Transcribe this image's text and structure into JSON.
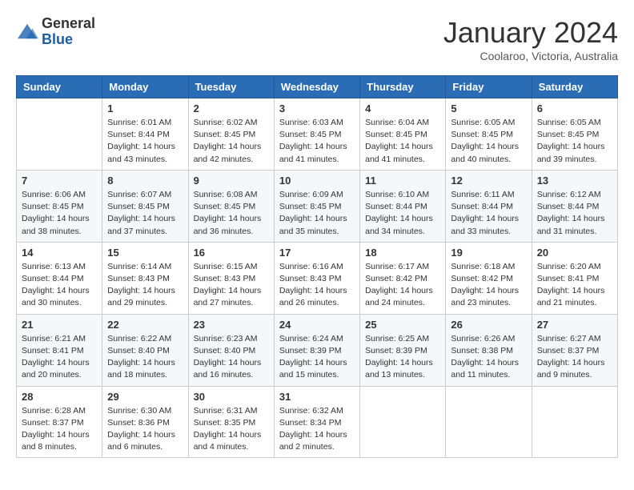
{
  "logo": {
    "line1": "General",
    "line2": "Blue"
  },
  "title": "January 2024",
  "location": "Coolaroo, Victoria, Australia",
  "days_header": [
    "Sunday",
    "Monday",
    "Tuesday",
    "Wednesday",
    "Thursday",
    "Friday",
    "Saturday"
  ],
  "weeks": [
    [
      {
        "day": "",
        "sunrise": "",
        "sunset": "",
        "daylight": ""
      },
      {
        "day": "1",
        "sunrise": "Sunrise: 6:01 AM",
        "sunset": "Sunset: 8:44 PM",
        "daylight": "Daylight: 14 hours and 43 minutes."
      },
      {
        "day": "2",
        "sunrise": "Sunrise: 6:02 AM",
        "sunset": "Sunset: 8:45 PM",
        "daylight": "Daylight: 14 hours and 42 minutes."
      },
      {
        "day": "3",
        "sunrise": "Sunrise: 6:03 AM",
        "sunset": "Sunset: 8:45 PM",
        "daylight": "Daylight: 14 hours and 41 minutes."
      },
      {
        "day": "4",
        "sunrise": "Sunrise: 6:04 AM",
        "sunset": "Sunset: 8:45 PM",
        "daylight": "Daylight: 14 hours and 41 minutes."
      },
      {
        "day": "5",
        "sunrise": "Sunrise: 6:05 AM",
        "sunset": "Sunset: 8:45 PM",
        "daylight": "Daylight: 14 hours and 40 minutes."
      },
      {
        "day": "6",
        "sunrise": "Sunrise: 6:05 AM",
        "sunset": "Sunset: 8:45 PM",
        "daylight": "Daylight: 14 hours and 39 minutes."
      }
    ],
    [
      {
        "day": "7",
        "sunrise": "Sunrise: 6:06 AM",
        "sunset": "Sunset: 8:45 PM",
        "daylight": "Daylight: 14 hours and 38 minutes."
      },
      {
        "day": "8",
        "sunrise": "Sunrise: 6:07 AM",
        "sunset": "Sunset: 8:45 PM",
        "daylight": "Daylight: 14 hours and 37 minutes."
      },
      {
        "day": "9",
        "sunrise": "Sunrise: 6:08 AM",
        "sunset": "Sunset: 8:45 PM",
        "daylight": "Daylight: 14 hours and 36 minutes."
      },
      {
        "day": "10",
        "sunrise": "Sunrise: 6:09 AM",
        "sunset": "Sunset: 8:45 PM",
        "daylight": "Daylight: 14 hours and 35 minutes."
      },
      {
        "day": "11",
        "sunrise": "Sunrise: 6:10 AM",
        "sunset": "Sunset: 8:44 PM",
        "daylight": "Daylight: 14 hours and 34 minutes."
      },
      {
        "day": "12",
        "sunrise": "Sunrise: 6:11 AM",
        "sunset": "Sunset: 8:44 PM",
        "daylight": "Daylight: 14 hours and 33 minutes."
      },
      {
        "day": "13",
        "sunrise": "Sunrise: 6:12 AM",
        "sunset": "Sunset: 8:44 PM",
        "daylight": "Daylight: 14 hours and 31 minutes."
      }
    ],
    [
      {
        "day": "14",
        "sunrise": "Sunrise: 6:13 AM",
        "sunset": "Sunset: 8:44 PM",
        "daylight": "Daylight: 14 hours and 30 minutes."
      },
      {
        "day": "15",
        "sunrise": "Sunrise: 6:14 AM",
        "sunset": "Sunset: 8:43 PM",
        "daylight": "Daylight: 14 hours and 29 minutes."
      },
      {
        "day": "16",
        "sunrise": "Sunrise: 6:15 AM",
        "sunset": "Sunset: 8:43 PM",
        "daylight": "Daylight: 14 hours and 27 minutes."
      },
      {
        "day": "17",
        "sunrise": "Sunrise: 6:16 AM",
        "sunset": "Sunset: 8:43 PM",
        "daylight": "Daylight: 14 hours and 26 minutes."
      },
      {
        "day": "18",
        "sunrise": "Sunrise: 6:17 AM",
        "sunset": "Sunset: 8:42 PM",
        "daylight": "Daylight: 14 hours and 24 minutes."
      },
      {
        "day": "19",
        "sunrise": "Sunrise: 6:18 AM",
        "sunset": "Sunset: 8:42 PM",
        "daylight": "Daylight: 14 hours and 23 minutes."
      },
      {
        "day": "20",
        "sunrise": "Sunrise: 6:20 AM",
        "sunset": "Sunset: 8:41 PM",
        "daylight": "Daylight: 14 hours and 21 minutes."
      }
    ],
    [
      {
        "day": "21",
        "sunrise": "Sunrise: 6:21 AM",
        "sunset": "Sunset: 8:41 PM",
        "daylight": "Daylight: 14 hours and 20 minutes."
      },
      {
        "day": "22",
        "sunrise": "Sunrise: 6:22 AM",
        "sunset": "Sunset: 8:40 PM",
        "daylight": "Daylight: 14 hours and 18 minutes."
      },
      {
        "day": "23",
        "sunrise": "Sunrise: 6:23 AM",
        "sunset": "Sunset: 8:40 PM",
        "daylight": "Daylight: 14 hours and 16 minutes."
      },
      {
        "day": "24",
        "sunrise": "Sunrise: 6:24 AM",
        "sunset": "Sunset: 8:39 PM",
        "daylight": "Daylight: 14 hours and 15 minutes."
      },
      {
        "day": "25",
        "sunrise": "Sunrise: 6:25 AM",
        "sunset": "Sunset: 8:39 PM",
        "daylight": "Daylight: 14 hours and 13 minutes."
      },
      {
        "day": "26",
        "sunrise": "Sunrise: 6:26 AM",
        "sunset": "Sunset: 8:38 PM",
        "daylight": "Daylight: 14 hours and 11 minutes."
      },
      {
        "day": "27",
        "sunrise": "Sunrise: 6:27 AM",
        "sunset": "Sunset: 8:37 PM",
        "daylight": "Daylight: 14 hours and 9 minutes."
      }
    ],
    [
      {
        "day": "28",
        "sunrise": "Sunrise: 6:28 AM",
        "sunset": "Sunset: 8:37 PM",
        "daylight": "Daylight: 14 hours and 8 minutes."
      },
      {
        "day": "29",
        "sunrise": "Sunrise: 6:30 AM",
        "sunset": "Sunset: 8:36 PM",
        "daylight": "Daylight: 14 hours and 6 minutes."
      },
      {
        "day": "30",
        "sunrise": "Sunrise: 6:31 AM",
        "sunset": "Sunset: 8:35 PM",
        "daylight": "Daylight: 14 hours and 4 minutes."
      },
      {
        "day": "31",
        "sunrise": "Sunrise: 6:32 AM",
        "sunset": "Sunset: 8:34 PM",
        "daylight": "Daylight: 14 hours and 2 minutes."
      },
      {
        "day": "",
        "sunrise": "",
        "sunset": "",
        "daylight": ""
      },
      {
        "day": "",
        "sunrise": "",
        "sunset": "",
        "daylight": ""
      },
      {
        "day": "",
        "sunrise": "",
        "sunset": "",
        "daylight": ""
      }
    ]
  ]
}
